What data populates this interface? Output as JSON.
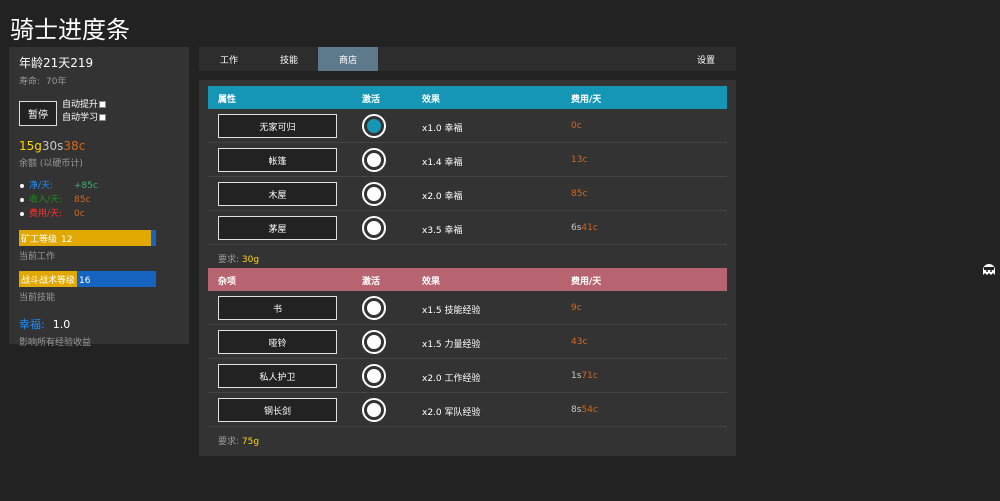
{
  "app": {
    "title": "骑士进度条"
  },
  "status": {
    "age_label": "年龄21天219",
    "lifespan_label": "寿命:",
    "lifespan_value": "70年",
    "pause_label": "暂停",
    "auto_promote_label": "自动提升",
    "auto_learn_label": "自动学习",
    "coins": {
      "gold": "15g",
      "silver": "30s",
      "copper": "38c"
    },
    "coins_sub": "余额 (以硬币计)",
    "net_label": "净/天:",
    "net_value": "+85c",
    "income_label": "收入/天:",
    "income_value": "85c",
    "expense_label": "费用/天:",
    "expense_value": "0c",
    "job_bar": {
      "label": "矿工等级",
      "level": "12",
      "progress": 0.96
    },
    "job_sub": "当前工作",
    "skill_bar": {
      "label": "战斗战术等级",
      "level": "16",
      "progress": 0.42
    },
    "skill_sub": "当前技能",
    "happiness_label": "幸福:",
    "happiness_value": "1.0",
    "happiness_sub": "影响所有经验收益"
  },
  "tabs": [
    {
      "label": "工作",
      "active": false
    },
    {
      "label": "技能",
      "active": false
    },
    {
      "label": "商店",
      "active": true
    },
    {
      "label": "设置",
      "active": false
    }
  ],
  "properties": {
    "headers": [
      "属性",
      "激活",
      "效果",
      "费用/天"
    ],
    "color": "#1496b4",
    "items": [
      {
        "name": "无家可归",
        "active": true,
        "effect": "x1.0 幸福",
        "cost_silver": "",
        "cost_copper": "0c"
      },
      {
        "name": "帐篷",
        "active": false,
        "effect": "x1.4 幸福",
        "cost_silver": "",
        "cost_copper": "13c"
      },
      {
        "name": "木屋",
        "active": false,
        "effect": "x2.0 幸福",
        "cost_silver": "",
        "cost_copper": "85c"
      },
      {
        "name": "茅屋",
        "active": false,
        "effect": "x3.5 幸福",
        "cost_silver": "6s",
        "cost_copper": "41c"
      }
    ],
    "req_label": "要求:",
    "req_value": "30g"
  },
  "misc": {
    "headers": [
      "杂项",
      "激活",
      "效果",
      "费用/天"
    ],
    "color": "#b86470",
    "items": [
      {
        "name": "书",
        "active": false,
        "effect": "x1.5 技能经验",
        "cost_silver": "",
        "cost_copper": "9c"
      },
      {
        "name": "哑铃",
        "active": false,
        "effect": "x1.5 力量经验",
        "cost_silver": "",
        "cost_copper": "43c"
      },
      {
        "name": "私人护卫",
        "active": false,
        "effect": "x2.0 工作经验",
        "cost_silver": "1s",
        "cost_copper": "71c"
      },
      {
        "name": "钢长剑",
        "active": false,
        "effect": "x2.0 军队经验",
        "cost_silver": "8s",
        "cost_copper": "54c"
      }
    ],
    "req_label": "要求:",
    "req_value": "75g"
  }
}
